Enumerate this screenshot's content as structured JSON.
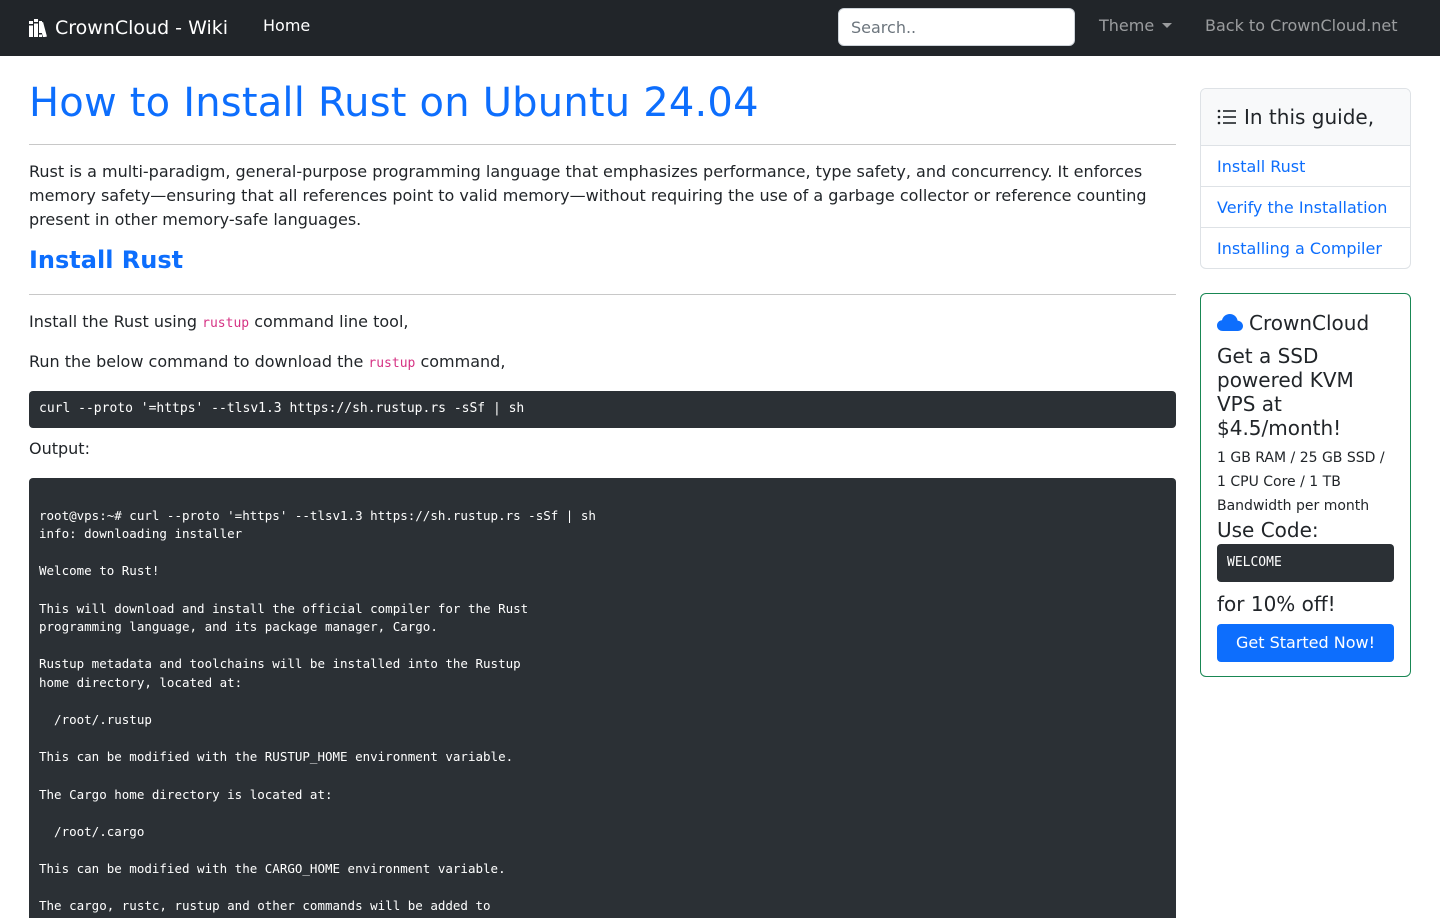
{
  "navbar": {
    "brand": "CrownCloud - Wiki",
    "brand_icon": "books-icon",
    "home": "Home",
    "search_placeholder": "Search..",
    "theme": "Theme",
    "back_link": "Back to CrownCloud.net"
  },
  "article": {
    "title": "How to Install Rust on Ubuntu 24.04",
    "intro": "Rust is a multi-paradigm, general-purpose programming language that emphasizes performance, type safety, and concurrency. It enforces memory safety—ensuring that all references point to valid memory—without requiring the use of a garbage collector or reference counting present in other memory-safe languages.",
    "section_heading": "Install Rust",
    "para1": {
      "before": "Install the Rust using ",
      "code": "rustup",
      "after": " command line tool,"
    },
    "para2": {
      "before": "Run the below command to download the ",
      "code": "rustup",
      "after": " command,"
    },
    "command": "curl --proto '=https' --tlsv1.3 https://sh.rustup.rs -sSf | sh",
    "output_label": "Output:",
    "output_lines": [
      "",
      "root@vps:~# curl --proto '=https' --tlsv1.3 https://sh.rustup.rs -sSf | sh",
      "info: downloading installer",
      "",
      "Welcome to Rust!",
      "",
      "This will download and install the official compiler for the Rust",
      "programming language, and its package manager, Cargo.",
      "",
      "Rustup metadata and toolchains will be installed into the Rustup",
      "home directory, located at:",
      "",
      "  /root/.rustup",
      "",
      "This can be modified with the RUSTUP_HOME environment variable.",
      "",
      "The Cargo home directory is located at:",
      "",
      "  /root/.cargo",
      "",
      "This can be modified with the CARGO_HOME environment variable.",
      "",
      "The cargo, rustc, rustup and other commands will be added to"
    ]
  },
  "toc": {
    "header": "In this guide,",
    "header_icon": "list-icon",
    "items": [
      {
        "label": "Install Rust"
      },
      {
        "label": "Verify the Installation"
      },
      {
        "label": "Installing a Compiler"
      }
    ]
  },
  "promo": {
    "icon": "cloud-icon",
    "title": "CrownCloud",
    "headline": "Get a SSD powered KVM VPS at $4.5/month!",
    "specs": "1 GB RAM / 25 GB SSD / 1 CPU Core / 1 TB Bandwidth per month",
    "use_code": "Use Code:",
    "code": "WELCOME",
    "discount": "for 10% off!",
    "button": "Get Started Now!"
  },
  "colors": {
    "navbar_bg": "#212529",
    "link_blue": "#0d6efd",
    "code_pink": "#d63384",
    "code_bg": "#2b3035",
    "promo_border": "#198754",
    "cloud_icon": "#0d6efd"
  }
}
